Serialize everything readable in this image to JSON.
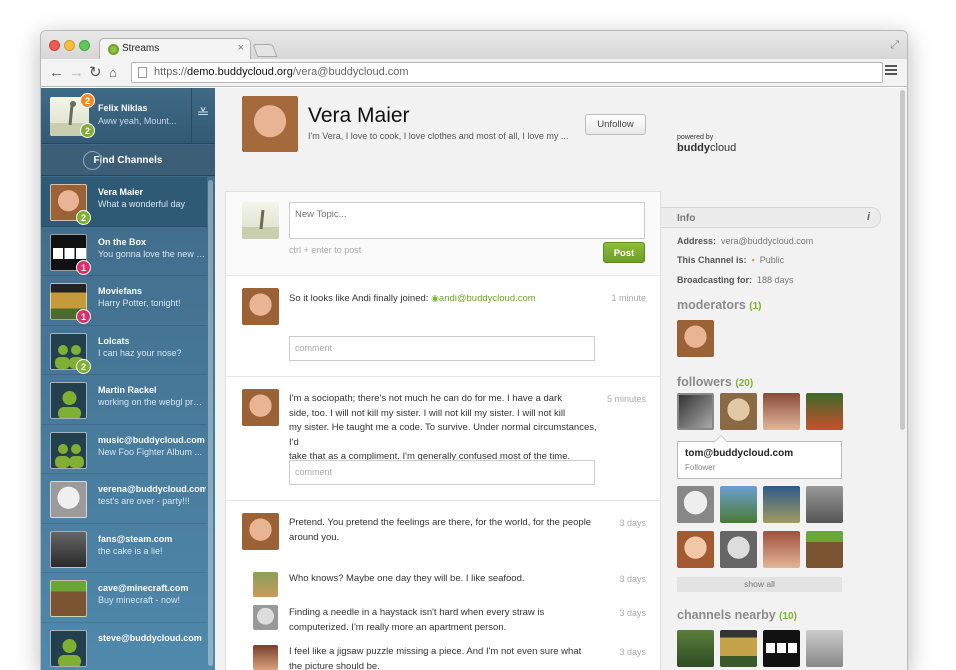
{
  "browser": {
    "tab_title": "Streams",
    "tab_close": "×",
    "url_prefix": "https://",
    "url_host": "demo.buddycloud.org",
    "url_path": "/vera@buddycloud.com"
  },
  "sidebar": {
    "me": {
      "name": "Felix Niklas",
      "status": "Aww yeah, Mount...",
      "badge_top": "2",
      "badge_bottom": "2"
    },
    "find_channels": "Find Channels",
    "channels": [
      {
        "name": "Vera Maier",
        "sub": "What a wonderful day",
        "badge": "2",
        "badge_color": "#7fb034",
        "avatar": "vera"
      },
      {
        "name": "On the Box",
        "sub": "You gonna love the new Doct...",
        "badge": "1",
        "badge_color": "#d6336c",
        "avatar": "bbc"
      },
      {
        "name": "Moviefans",
        "sub": "Harry Potter, tonight!",
        "badge": "1",
        "badge_color": "#d6336c",
        "avatar": "movie"
      },
      {
        "name": "Lolcats",
        "sub": "I can haz your nose?",
        "badge": "2",
        "badge_color": "#7fb034",
        "avatar": "group"
      },
      {
        "name": "Martin Rackel",
        "sub": "working on the webgl preview...",
        "badge": "",
        "badge_color": "",
        "avatar": "person"
      },
      {
        "name": "music@buddycloud.com",
        "sub": "New Foo Fighter Album ...",
        "badge": "",
        "badge_color": "",
        "avatar": "group"
      },
      {
        "name": "verena@buddycloud.com",
        "sub": "test's are over - party!!!",
        "badge": "",
        "badge_color": "",
        "avatar": "glasses"
      },
      {
        "name": "fans@steam.com",
        "sub": "the cake is a lie!",
        "badge": "",
        "badge_color": "",
        "avatar": "steam"
      },
      {
        "name": "cave@minecraft.com",
        "sub": "Buy minecraft - now!",
        "badge": "",
        "badge_color": "",
        "avatar": "minecraft"
      },
      {
        "name": "steve@buddycloud.com",
        "sub": "",
        "badge": "",
        "badge_color": "",
        "avatar": "person"
      }
    ]
  },
  "channel": {
    "name": "Vera Maier",
    "description": "I'm Vera, I love to cook, I love clothes and most of all, I love my ...",
    "unfollow_label": "Unfollow"
  },
  "composer": {
    "placeholder": "New Topic...",
    "hint": "ctrl + enter to post",
    "post_label": "Post"
  },
  "posts": [
    {
      "text": "So it looks like Andi finally joined:",
      "mention": "andi@buddycloud.com",
      "time": "1 minute",
      "comment_placeholder": "comment"
    },
    {
      "lines": [
        "I'm a sociopath; there's not much he can do for me. I have a dark",
        "side, too. I will not kill my sister. I will not kill my sister. I will not kill",
        "my sister. He taught me a code. To survive. Under normal circumstances, I'd",
        "take that as a compliment. I'm generally confused most of the time."
      ],
      "time": "5 minutes",
      "comment_placeholder": "comment"
    },
    {
      "lines": [
        "Pretend. You pretend the feelings are there, for the world, for the people",
        "around you."
      ],
      "time": "3 days",
      "replies": [
        {
          "lines": [
            "Who knows? Maybe one day they will be. I like seafood."
          ],
          "time": "3 days"
        },
        {
          "lines": [
            "Finding a needle in a haystack isn't hard when every straw is",
            "computerized. I'm really more an apartment person."
          ],
          "time": "3 days"
        },
        {
          "lines": [
            "I feel like a jigsaw puzzle missing a piece. And I'm not even sure what",
            "the picture should be."
          ],
          "time": "3 days"
        }
      ]
    }
  ],
  "right": {
    "powered_by": "powered by",
    "brand_a": "buddy",
    "brand_b": "cloud",
    "info_title": "Info",
    "address_label": "Address:",
    "address_value": "vera@buddycloud.com",
    "channel_is_label": "This Channel is:",
    "channel_is_value": "Public",
    "broadcasting_label": "Broadcasting for:",
    "broadcasting_value": "188 days",
    "moderators_title": "moderators",
    "moderators_count": "(1)",
    "followers_title": "followers",
    "followers_count": "(20)",
    "tooltip_name": "tom@buddycloud.com",
    "tooltip_role": "Follower",
    "show_all": "show all",
    "nearby_title": "channels nearby",
    "nearby_count": "(10)"
  },
  "colors": {
    "accent_green": "#7fb034",
    "sidebar_blue": "#4a7fa0",
    "badge_pink": "#d6336c"
  }
}
